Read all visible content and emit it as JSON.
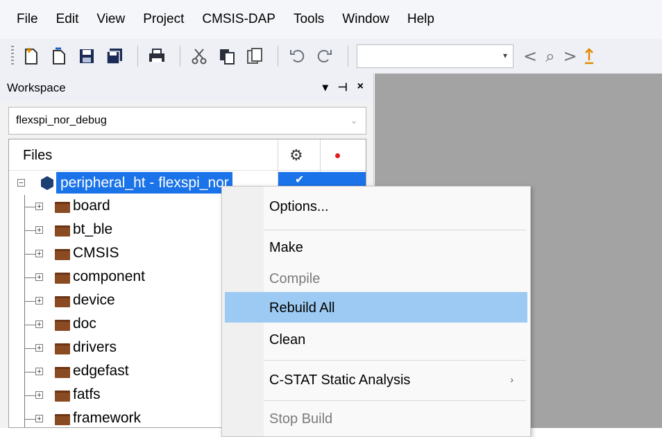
{
  "menubar": {
    "items": [
      "File",
      "Edit",
      "View",
      "Project",
      "CMSIS-DAP",
      "Tools",
      "Window",
      "Help"
    ]
  },
  "toolbar": {
    "buttons": [
      "new-file-icon",
      "open-file-icon",
      "save-icon",
      "save-all-icon",
      "print-icon",
      "cut-icon",
      "copy-icon",
      "paste-icon",
      "undo-icon",
      "redo-icon"
    ],
    "search_value": "",
    "right_glyphs": [
      "<",
      "⌕",
      ">"
    ]
  },
  "workspace": {
    "title": "Workspace",
    "controls": [
      "▾",
      "⊣",
      "×"
    ],
    "config": "flexspi_nor_debug",
    "files_header": "Files",
    "root": "peripheral_ht - flexspi_nor_debug",
    "items": [
      "board",
      "bt_ble",
      "CMSIS",
      "component",
      "device",
      "doc",
      "drivers",
      "edgefast",
      "fatfs",
      "framework"
    ]
  },
  "context_menu": {
    "items": [
      {
        "label": "Options...",
        "enabled": true
      },
      {
        "label": "Make",
        "enabled": true
      },
      {
        "label": "Compile",
        "enabled": false
      },
      {
        "label": "Rebuild All",
        "enabled": true,
        "highlighted": true
      },
      {
        "label": "Clean",
        "enabled": true
      },
      {
        "label": "C-STAT Static Analysis",
        "enabled": true,
        "submenu": true
      },
      {
        "label": "Stop Build",
        "enabled": false
      }
    ]
  },
  "colors": {
    "selection": "#1a73e8",
    "menu_highlight": "#9dcaf2",
    "editor_bg": "#a3a3a3"
  }
}
